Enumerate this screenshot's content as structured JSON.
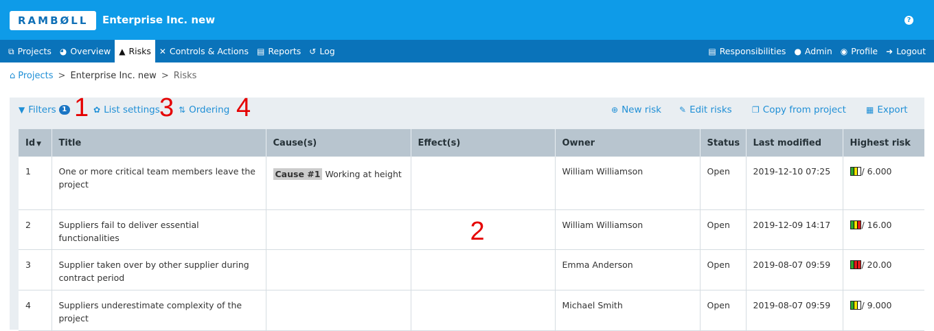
{
  "header": {
    "logo": "RAMBØLL",
    "company": "Enterprise Inc. new",
    "help_icon": "question-circle-icon"
  },
  "nav": {
    "left": [
      {
        "label": "Projects",
        "icon": "sitemap-icon"
      },
      {
        "label": "Overview",
        "icon": "pie-chart-icon"
      },
      {
        "label": "Risks",
        "icon": "warning-icon",
        "active": true
      },
      {
        "label": "Controls & Actions",
        "icon": "tools-icon"
      },
      {
        "label": "Reports",
        "icon": "file-icon"
      },
      {
        "label": "Log",
        "icon": "history-icon"
      }
    ],
    "right": [
      {
        "label": "Responsibilities",
        "icon": "clipboard-icon"
      },
      {
        "label": "Admin",
        "icon": "users-cog-icon"
      },
      {
        "label": "Profile",
        "icon": "user-circle-icon"
      },
      {
        "label": "Logout",
        "icon": "sign-out-icon"
      }
    ]
  },
  "breadcrumb": {
    "home": "Projects",
    "project": "Enterprise Inc. new",
    "current": "Risks",
    "separator": ">"
  },
  "toolbar": {
    "filters": "Filters",
    "filters_count": "1",
    "list_settings": "List settings",
    "ordering": "Ordering",
    "new_risk": "New risk",
    "edit_risks": "Edit risks",
    "copy_from_project": "Copy from project",
    "export": "Export"
  },
  "markers": [
    "1",
    "2",
    "3",
    "4"
  ],
  "table": {
    "columns": [
      "Id",
      "Title",
      "Cause(s)",
      "Effect(s)",
      "Owner",
      "Status",
      "Last modified",
      "Highest risk"
    ],
    "rows": [
      {
        "id": "1",
        "title": "One or more critical team members leave the project",
        "cause_tag": "Cause #1",
        "cause_text": "Working at height",
        "effect": "",
        "owner": "William Williamson",
        "status": "Open",
        "modified": "2019-12-10 07:25",
        "risk": "/ 6.000"
      },
      {
        "id": "2",
        "title": "Suppliers fail to deliver essential functionalities",
        "cause_tag": "",
        "cause_text": "",
        "effect": "",
        "owner": "William Williamson",
        "status": "Open",
        "modified": "2019-12-09 14:17",
        "risk": "/ 16.00"
      },
      {
        "id": "3",
        "title": "Supplier taken over by other supplier during contract period",
        "cause_tag": "",
        "cause_text": "",
        "effect": "",
        "owner": "Emma Anderson",
        "status": "Open",
        "modified": "2019-08-07 09:59",
        "risk": "/ 20.00"
      },
      {
        "id": "4",
        "title": "Suppliers underestimate complexity of the project",
        "cause_tag": "",
        "cause_text": "",
        "effect": "",
        "owner": "Michael Smith",
        "status": "Open",
        "modified": "2019-08-07 09:59",
        "risk": "/ 9.000"
      }
    ]
  },
  "colors": {
    "header_bg": "#0e9be8",
    "nav_bg": "#0a73ba",
    "link": "#1f8fd6",
    "marker": "#e50000",
    "heat_green": "#2ea82e",
    "heat_yellow": "#f2e600",
    "heat_red": "#e21b1b"
  }
}
